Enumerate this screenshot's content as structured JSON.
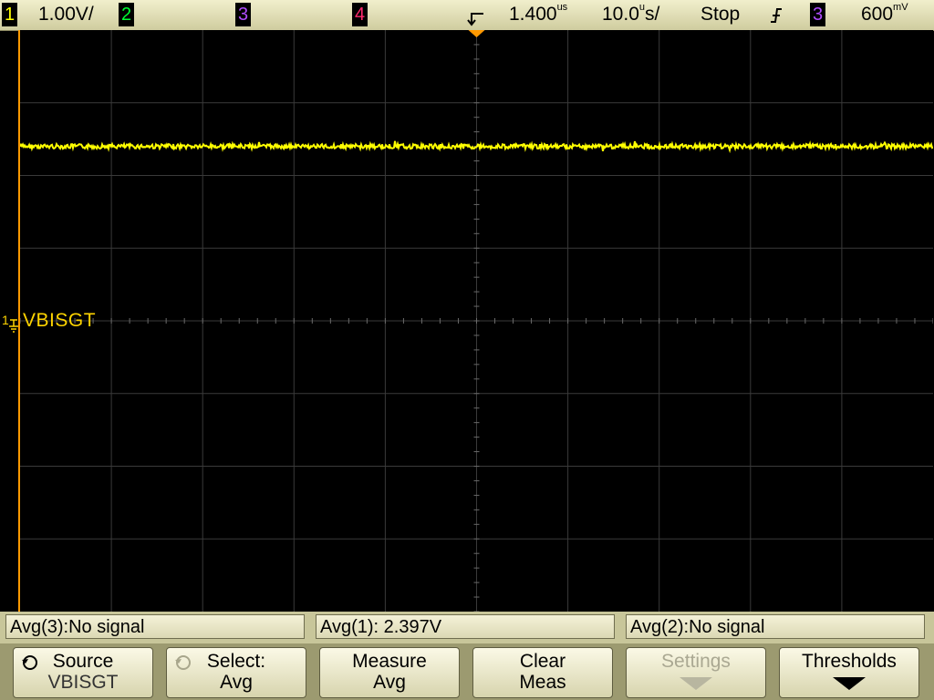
{
  "top": {
    "ch1_num": "1",
    "ch1_scale": "1.00V/",
    "ch2_num": "2",
    "ch3_num": "3",
    "ch4_num": "4",
    "delay": "1.400",
    "delay_unit": "us",
    "timebase": "10.0",
    "timebase_unit": "s/",
    "timebase_unit_prefix": "u",
    "run_state": "Stop",
    "trig_source": "3",
    "trig_level": "600",
    "trig_level_unit": "mV"
  },
  "trace": {
    "label": "VBISGT",
    "ground_marker": "1",
    "level_div": 2.4,
    "color": "#ffff00"
  },
  "measurements": [
    {
      "text": "Avg(3):No signal"
    },
    {
      "text": "Avg(1): 2.397V"
    },
    {
      "text": "Avg(2):No signal"
    }
  ],
  "softkeys": [
    {
      "line1": "Source",
      "line2": "VBISGT"
    },
    {
      "line1": "Select:",
      "line2": "Avg"
    },
    {
      "line1": "Measure",
      "line2": "Avg"
    },
    {
      "line1": "Clear",
      "line2": "Meas"
    },
    {
      "line1": "Settings",
      "line2": ""
    },
    {
      "line1": "Thresholds",
      "line2": ""
    }
  ],
  "colors": {
    "ch1": "#ffff00",
    "ch2": "#00ff33",
    "ch3": "#b04cff",
    "ch4": "#ff2a6d",
    "trigger_marker": "#ff9900"
  }
}
